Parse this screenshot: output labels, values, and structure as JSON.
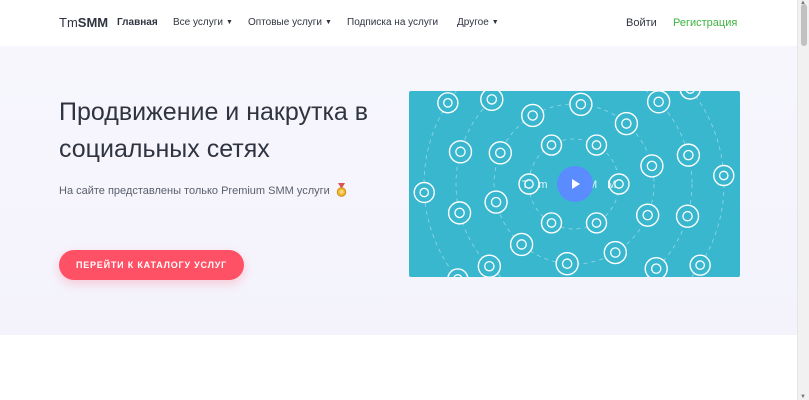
{
  "nav": {
    "logo_light": "Tm",
    "logo_bold": "SMM",
    "items": [
      {
        "label": "Главная",
        "active": true,
        "dropdown": false
      },
      {
        "label": "Все услуги",
        "active": false,
        "dropdown": true
      },
      {
        "label": "Оптовые услуги",
        "active": false,
        "dropdown": true
      },
      {
        "label": "Подписка на услуги",
        "active": false,
        "dropdown": false
      },
      {
        "label": "Другое",
        "active": false,
        "dropdown": true
      }
    ],
    "login": "Войти",
    "register": "Регистрация",
    "register_color": "#3cb53f"
  },
  "hero": {
    "title": "Продвижение и накрутка в социальных сетях",
    "subtitle": "На сайте представлены только Premium SMM услуги",
    "subtitle_icon": "medal-icon",
    "cta": "ПЕРЕЙТИ К КАТАЛОГУ УСЛУГ",
    "cta_color": "#ff5166"
  },
  "video": {
    "background": "#39b7cf",
    "watermark": "Tm SMM",
    "play_icon": "play-icon",
    "play_color": "#5a8bff",
    "network_icons": [
      "tiktok-icon",
      "vk-icon",
      "heart-icon",
      "flickr-icon",
      "snapchat-icon",
      "twitch-icon",
      "vine-icon",
      "check-icon",
      "dropbox-icon",
      "instagram-icon",
      "facebook-icon",
      "viber-icon",
      "skype-icon",
      "share-icon",
      "telegram-icon",
      "linkedin-icon",
      "odnoklassniki-icon",
      "whatsapp-icon",
      "chat-icon"
    ]
  }
}
